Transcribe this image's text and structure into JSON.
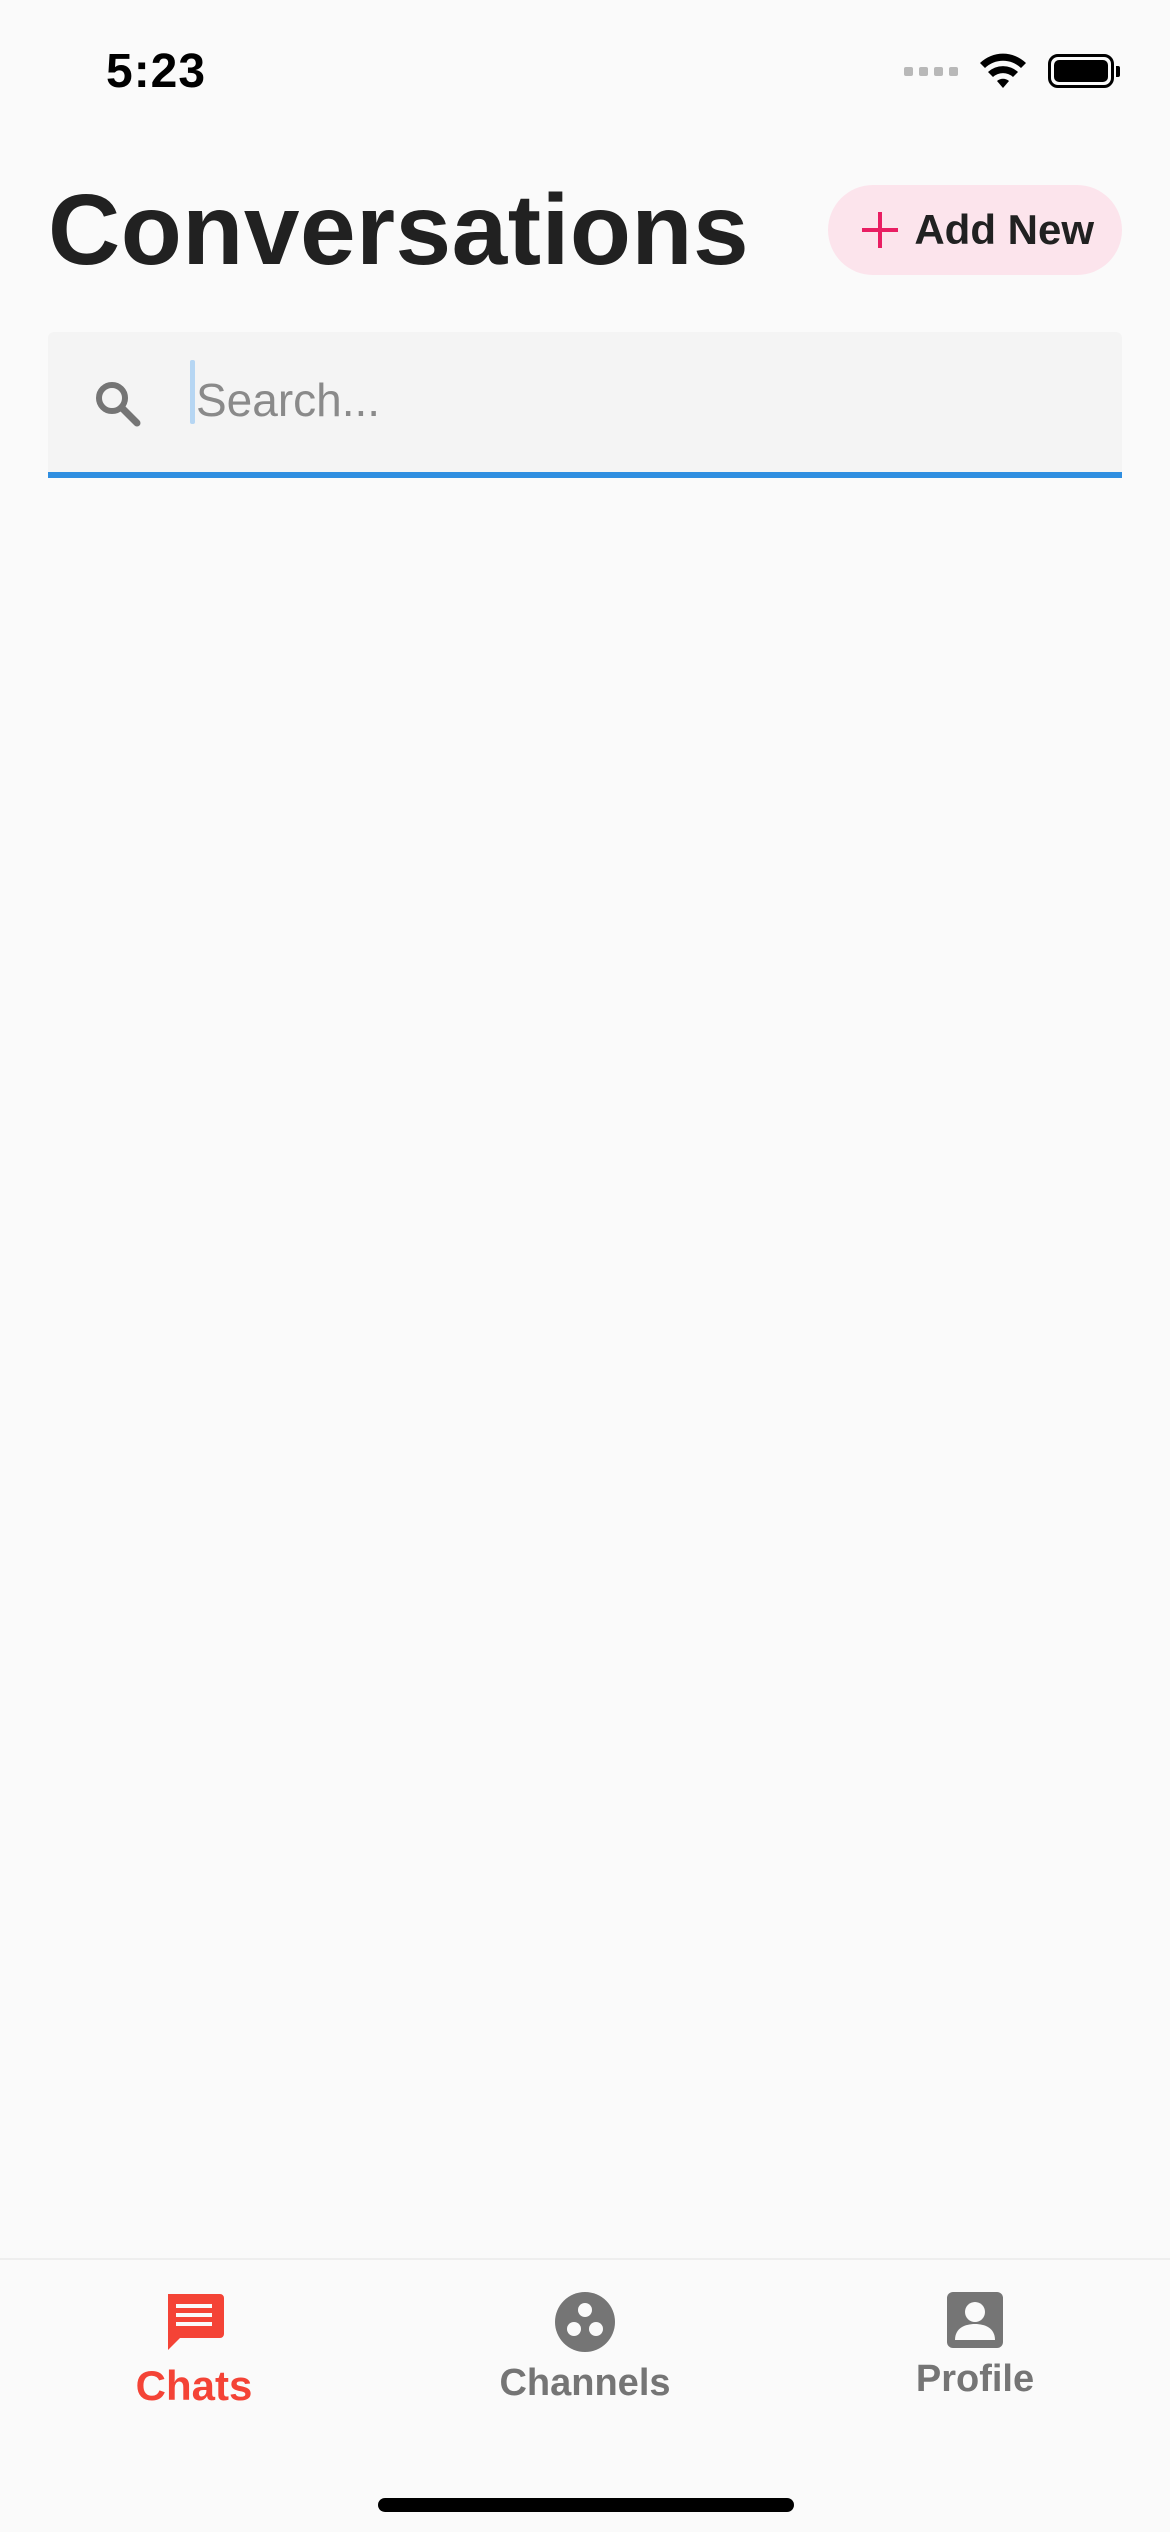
{
  "status_bar": {
    "time": "5:23",
    "icons": [
      "signal-icon",
      "wifi-icon",
      "battery-icon"
    ]
  },
  "header": {
    "title": "Conversations",
    "add_button_label": "Add New",
    "add_button_icon": "plus-icon"
  },
  "search": {
    "placeholder": "Search...",
    "value": "",
    "icon": "search-icon"
  },
  "conversations": [],
  "bottom_nav": {
    "items": [
      {
        "label": "Chats",
        "icon": "chat-icon",
        "active": true
      },
      {
        "label": "Channels",
        "icon": "channels-icon",
        "active": false
      },
      {
        "label": "Profile",
        "icon": "profile-icon",
        "active": false
      }
    ]
  },
  "colors": {
    "accent": "#f44336",
    "plus": "#e91e63",
    "add_button_bg": "#fce4ec",
    "search_underline": "#2f8ee0",
    "inactive_nav": "#757575",
    "background": "#fafafa"
  }
}
